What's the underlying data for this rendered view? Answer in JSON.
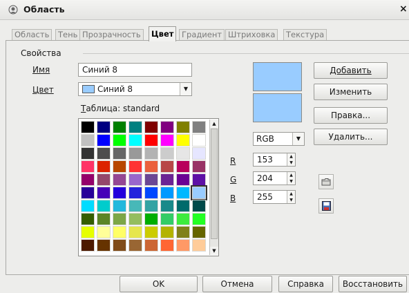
{
  "window": {
    "title": "Область"
  },
  "tabs": [
    "Область",
    "Тень",
    "Прозрачность",
    "Цвет",
    "Градиент",
    "Штриховка",
    "Текстура"
  ],
  "active_tab": "Цвет",
  "properties": {
    "group_title": "Свойства",
    "name_label": "Имя",
    "name_value": "Синий 8",
    "color_label": "Цвет",
    "color_value": "Синий 8",
    "table_label": "Таблица: standard"
  },
  "buttons": {
    "add": "Добавить",
    "change": "Изменить",
    "edit": "Правка...",
    "delete": "Удалить..."
  },
  "color_model": {
    "value": "RGB"
  },
  "rgb": {
    "r_label": "R",
    "r_value": "153",
    "g_label": "G",
    "g_value": "204",
    "b_label": "B",
    "b_value": "255"
  },
  "footer": {
    "ok": "OK",
    "cancel": "Отмена",
    "help": "Справка",
    "reset": "Восстановить"
  },
  "colors": {
    "preview": "#99ccff",
    "palette": [
      [
        "#000000",
        "#000080",
        "#008000",
        "#008080",
        "#800000",
        "#800080",
        "#808000",
        "#808080"
      ],
      [
        "#c0c0c0",
        "#0000ff",
        "#00ff00",
        "#00ffff",
        "#ff0000",
        "#ff00ff",
        "#ffff00",
        "#ffffff"
      ],
      [
        "#333333",
        "#4d4d4d",
        "#666666",
        "#999999",
        "#b3b3b3",
        "#cccccc",
        "#e6e6e6",
        "#e6e6ff"
      ],
      [
        "#ff3366",
        "#dc2300",
        "#b84700",
        "#ff3333",
        "#eb613d",
        "#b84747",
        "#b8005c",
        "#993366"
      ],
      [
        "#94006b",
        "#94476b",
        "#944794",
        "#9966cc",
        "#6b4794",
        "#6b2394",
        "#6b0094",
        "#5e11a6"
      ],
      [
        "#280099",
        "#4700b8",
        "#2300dc",
        "#2323dc",
        "#0047ff",
        "#0099ff",
        "#00b8ff",
        "#99ccff"
      ],
      [
        "#00dcff",
        "#00cccc",
        "#23b8dc",
        "#47b8b8",
        "#33a3a3",
        "#198a8a",
        "#006b6b",
        "#004a4a"
      ],
      [
        "#355e00",
        "#5c8526",
        "#7da647",
        "#94bd5e",
        "#00ae00",
        "#33cc66",
        "#3deb3d",
        "#23ff23"
      ],
      [
        "#e6ff00",
        "#ffff99",
        "#ffff66",
        "#e6e64c",
        "#cccc00",
        "#b3b300",
        "#808019",
        "#666600"
      ],
      [
        "#4c1900",
        "#663300",
        "#804c19",
        "#996633",
        "#cc6633",
        "#ff6633",
        "#ff9966",
        "#ffcc99"
      ]
    ],
    "selected_cell": [
      5,
      7
    ]
  }
}
